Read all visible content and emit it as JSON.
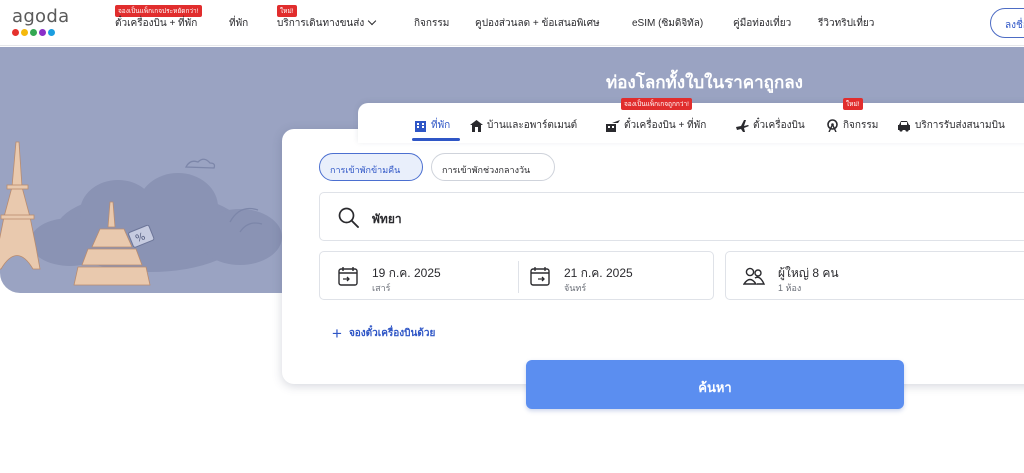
{
  "brand": {
    "name": "agoda",
    "dot_colors": [
      "#e5322d",
      "#f5b90c",
      "#34a853",
      "#8b2fc9",
      "#1b9ee0"
    ]
  },
  "nav": {
    "items": [
      {
        "label": "ตั๋วเครื่องบิน + ที่พัก",
        "badge": "จองเป็นแพ็กเกจประหยัดกว่า!"
      },
      {
        "label": "ที่พัก",
        "badge": ""
      },
      {
        "label": "บริการเดินทางขนส่ง",
        "badge": "ใหม่!"
      },
      {
        "label": "กิจกรรม",
        "badge": ""
      },
      {
        "label": "คูปองส่วนลด + ข้อเสนอพิเศษ",
        "badge": ""
      },
      {
        "label": "eSIM (ซิมดิจิทัล)",
        "badge": ""
      },
      {
        "label": "คู่มือท่องเที่ยว",
        "badge": ""
      },
      {
        "label": "รีวิวทริปเที่ยว",
        "badge": ""
      }
    ],
    "login_label": "ลงชื่อเข้าใช้"
  },
  "hero": {
    "title": "ท่องโลกทั้งใบในราคาถูกลง",
    "background_color": "#9aa3c2"
  },
  "tabs": [
    {
      "label": "ที่พัก",
      "icon": "building-icon",
      "active": true,
      "badge": ""
    },
    {
      "label": "บ้านและอพาร์ตเมนต์",
      "icon": "house-icon",
      "active": false,
      "badge": ""
    },
    {
      "label": "ตั๋วเครื่องบิน + ที่พัก",
      "icon": "flight-hotel-icon",
      "active": false,
      "badge": "จองเป็นแพ็กเกจถูกกว่า!"
    },
    {
      "label": "ตั๋วเครื่องบิน",
      "icon": "plane-icon",
      "active": false,
      "badge": ""
    },
    {
      "label": "กิจกรรม",
      "icon": "ferris-wheel-icon",
      "active": false,
      "badge": "ใหม่!"
    },
    {
      "label": "บริการรับส่งสนามบิน",
      "icon": "car-icon",
      "active": false,
      "badge": ""
    }
  ],
  "stay_type": {
    "options": [
      "การเข้าพักข้ามคืน",
      "การเข้าพักช่วงกลางวัน"
    ],
    "selected": "การเข้าพักข้ามคืน"
  },
  "search": {
    "destination": "พัทยา"
  },
  "dates": {
    "check_in": {
      "date": "19 ก.ค. 2025",
      "weekday": "เสาร์"
    },
    "check_out": {
      "date": "21 ก.ค. 2025",
      "weekday": "จันทร์"
    }
  },
  "guests": {
    "summary": "ผู้ใหญ่ 8 คน",
    "rooms": "1 ห้อง"
  },
  "add_flight_label": "จองตั๋วเครื่องบินด้วย",
  "search_button_label": "ค้นหา",
  "colors": {
    "accent": "#2f56c6",
    "button": "#5b8ef0",
    "badge": "#e12d2d"
  }
}
